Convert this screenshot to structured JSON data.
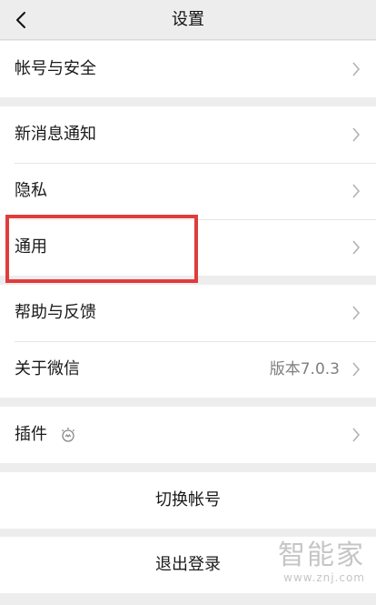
{
  "header": {
    "title": "设置"
  },
  "groups": {
    "account": {
      "item": "帐号与安全"
    },
    "main": {
      "notifications": "新消息通知",
      "privacy": "隐私",
      "general": "通用"
    },
    "help": {
      "feedback": "帮助与反馈",
      "about": "关于微信",
      "about_value": "版本7.0.3"
    },
    "plugins": {
      "item": "插件"
    }
  },
  "actions": {
    "switch_account": "切换帐号",
    "logout": "退出登录"
  },
  "watermark": {
    "brand": "智能家",
    "url": "www.znj.com"
  },
  "colors": {
    "highlight": "#e03c3c",
    "background": "#ededed"
  }
}
